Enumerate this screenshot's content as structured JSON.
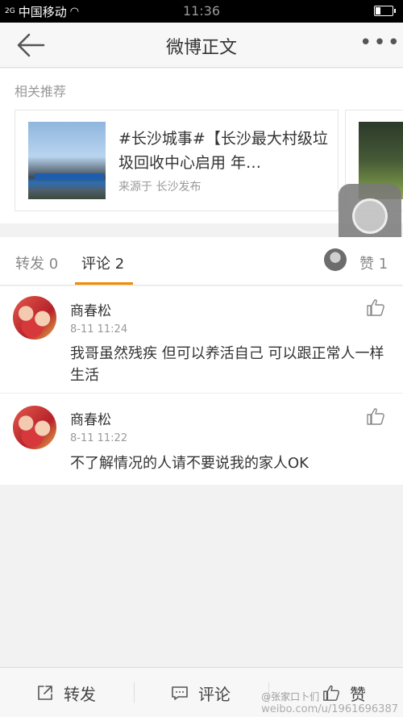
{
  "status_bar": {
    "signal": "2G",
    "carrier": "中国移动",
    "time": "11:36"
  },
  "header": {
    "title": "微博正文"
  },
  "recommend": {
    "label": "相关推荐",
    "card": {
      "title": "#长沙城事#【长沙最大村级垃圾回收中心启用 年…",
      "source": "来源于 长沙发布"
    }
  },
  "tabs": {
    "repost": "转发 0",
    "comment": "评论 2",
    "likes": "赞 1"
  },
  "comments": [
    {
      "author": "商春松",
      "time": "8-11 11:24",
      "text": "我哥虽然残疾 但可以养活自己 可以跟正常人一样生活"
    },
    {
      "author": "商春松",
      "time": "8-11 11:22",
      "text": "不了解情况的人请不要说我的家人OK"
    }
  ],
  "bottom_bar": {
    "repost": "转发",
    "comment": "评论",
    "like": "赞"
  },
  "watermark": {
    "handle": "@张家口卜们",
    "url": "weibo.com/u/1961696387"
  },
  "colors": {
    "accent": "#f08a00",
    "background": "#f2f2f2"
  }
}
